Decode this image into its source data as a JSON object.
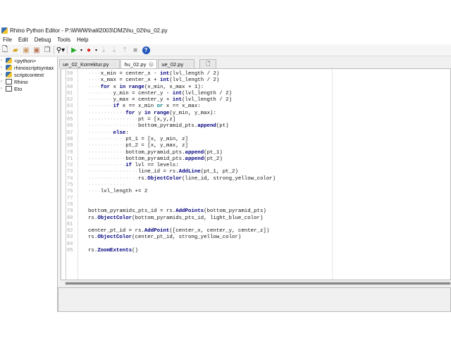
{
  "window": {
    "title": "Rhino Python Editor - P:\\WWW\\halil2003\\DM2\\hu_02\\hu_02.py"
  },
  "menu": [
    "File",
    "Edit",
    "Debug",
    "Tools",
    "Help"
  ],
  "toolbar": {
    "icons": [
      "new-file-icon",
      "open-folder-icon",
      "save-icon",
      "save-as-icon",
      "save-all-icon",
      "find-icon",
      "run-icon",
      "record-icon",
      "step-into-icon",
      "step-over-icon",
      "step-out-icon",
      "stop-icon",
      "help-icon"
    ]
  },
  "sidebar": {
    "items": [
      {
        "label": "<python>",
        "icon": "python-icon"
      },
      {
        "label": "rhinoscriptsyntax",
        "icon": "python-icon"
      },
      {
        "label": "scriptcontext",
        "icon": "python-icon"
      },
      {
        "label": "Rhino",
        "icon": "namespace-icon"
      },
      {
        "label": "Eto",
        "icon": "namespace-icon"
      }
    ]
  },
  "tabs": [
    {
      "label": "ue_02_Korrektur.py"
    },
    {
      "label": "hu_02.py",
      "active": true
    },
    {
      "label": "ue_02.py"
    }
  ],
  "code": [
    {
      "n": "58",
      "s": [
        [
          "····",
          "ind"
        ],
        [
          "x_min = center_x - ",
          ""
        ],
        [
          "int",
          "bi"
        ],
        [
          "(lvl_length / 2)",
          ""
        ]
      ]
    },
    {
      "n": "59",
      "s": [
        [
          "····",
          "ind"
        ],
        [
          "x_max = center_x + ",
          ""
        ],
        [
          "int",
          "bi"
        ],
        [
          "(lvl_length / 2)",
          ""
        ]
      ]
    },
    {
      "n": "60",
      "s": [
        [
          "····",
          "ind"
        ],
        [
          "for",
          "kw"
        ],
        [
          " x ",
          ""
        ],
        [
          "in",
          "kw"
        ],
        [
          " ",
          ""
        ],
        [
          "range",
          "bi"
        ],
        [
          "(x_min, x_max + 1):",
          ""
        ]
      ]
    },
    {
      "n": "61",
      "s": [
        [
          "········",
          "ind"
        ],
        [
          "y_min = center_y - ",
          ""
        ],
        [
          "int",
          "bi"
        ],
        [
          "(lvl_length / 2)",
          ""
        ]
      ]
    },
    {
      "n": "62",
      "s": [
        [
          "········",
          "ind"
        ],
        [
          "y_max = center_y + ",
          ""
        ],
        [
          "int",
          "bi"
        ],
        [
          "(lvl_length / 2)",
          ""
        ]
      ]
    },
    {
      "n": "63",
      "s": [
        [
          "········",
          "ind"
        ],
        [
          "if",
          "kw"
        ],
        [
          " x == x_min ",
          ""
        ],
        [
          "or",
          "op"
        ],
        [
          " x == x_max:",
          ""
        ]
      ]
    },
    {
      "n": "64",
      "s": [
        [
          "············",
          "ind"
        ],
        [
          "for",
          "kw"
        ],
        [
          " y ",
          ""
        ],
        [
          "in",
          "kw"
        ],
        [
          " ",
          ""
        ],
        [
          "range",
          "bi"
        ],
        [
          "(y_min, y_max):",
          ""
        ]
      ]
    },
    {
      "n": "65",
      "s": [
        [
          "················",
          "ind"
        ],
        [
          "pt = [x,y,z]",
          ""
        ]
      ]
    },
    {
      "n": "66",
      "s": [
        [
          "················",
          "ind"
        ],
        [
          "bottom_pyramid_pts.",
          ""
        ],
        [
          "append",
          "fn"
        ],
        [
          "(pt)",
          ""
        ]
      ]
    },
    {
      "n": "67",
      "s": [
        [
          "········",
          "ind"
        ],
        [
          "else",
          "kw"
        ],
        [
          ":",
          ""
        ]
      ]
    },
    {
      "n": "68",
      "s": [
        [
          "············",
          "ind"
        ],
        [
          "pt_1 = [x, y_min, z]",
          ""
        ]
      ]
    },
    {
      "n": "69",
      "s": [
        [
          "············",
          "ind"
        ],
        [
          "pt_2 = [x, y_max, z]",
          ""
        ]
      ]
    },
    {
      "n": "70",
      "s": [
        [
          "············",
          "ind"
        ],
        [
          "bottom_pyramid_pts.",
          ""
        ],
        [
          "append",
          "fn"
        ],
        [
          "(pt_1)",
          ""
        ]
      ]
    },
    {
      "n": "71",
      "s": [
        [
          "············",
          "ind"
        ],
        [
          "bottom_pyramid_pts.",
          ""
        ],
        [
          "append",
          "fn"
        ],
        [
          "(pt_2)",
          ""
        ]
      ]
    },
    {
      "n": "72",
      "s": [
        [
          "············",
          "ind"
        ],
        [
          "if",
          "kw"
        ],
        [
          " lvl == levels:",
          ""
        ]
      ]
    },
    {
      "n": "73",
      "s": [
        [
          "················",
          "ind"
        ],
        [
          "line_id = rs.",
          ""
        ],
        [
          "AddLine",
          "fn"
        ],
        [
          "(pt_1, pt_2)",
          ""
        ]
      ]
    },
    {
      "n": "74",
      "s": [
        [
          "················",
          "ind"
        ],
        [
          "rs.",
          ""
        ],
        [
          "ObjectColor",
          "fn"
        ],
        [
          "(line_id, strong_yellow_color)",
          ""
        ]
      ]
    },
    {
      "n": "75",
      "s": [
        [
          "············",
          "ind"
        ]
      ]
    },
    {
      "n": "76",
      "s": [
        [
          "····",
          "ind"
        ],
        [
          "lvl_length += 2",
          ""
        ]
      ]
    },
    {
      "n": "77",
      "s": []
    },
    {
      "n": "78",
      "s": []
    },
    {
      "n": "79",
      "s": [
        [
          "bottom_pyramids_pts_id = rs.",
          ""
        ],
        [
          "AddPoints",
          "fn"
        ],
        [
          "(bottom_pyramid_pts)",
          ""
        ]
      ]
    },
    {
      "n": "80",
      "s": [
        [
          "rs.",
          ""
        ],
        [
          "ObjectColor",
          "fn"
        ],
        [
          "(bottom_pyramids_pts_id, light_blue_color)",
          ""
        ]
      ]
    },
    {
      "n": "81",
      "s": []
    },
    {
      "n": "82",
      "s": [
        [
          "center_pt_id = rs.",
          ""
        ],
        [
          "AddPoint",
          "fn"
        ],
        [
          "([center_x, center_y, center_z])",
          ""
        ]
      ]
    },
    {
      "n": "83",
      "s": [
        [
          "rs.",
          ""
        ],
        [
          "ObjectColor",
          "fn"
        ],
        [
          "(center_pt_id, strong_yellow_color)",
          ""
        ]
      ]
    },
    {
      "n": "84",
      "s": []
    },
    {
      "n": "85",
      "s": [
        [
          "rs.",
          ""
        ],
        [
          "ZoomExtents",
          "fn"
        ],
        [
          "()",
          ""
        ]
      ]
    }
  ]
}
